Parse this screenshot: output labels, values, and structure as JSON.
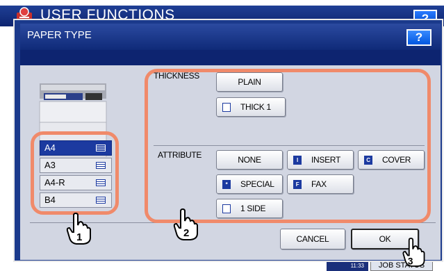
{
  "background": {
    "title": "USER FUNCTIONS",
    "help_label": "?",
    "clock": "11:33",
    "job_status": "JOB STATUS"
  },
  "dialog": {
    "title": "PAPER TYPE",
    "help_label": "?"
  },
  "paper_sizes": [
    {
      "label": "A4",
      "selected": true
    },
    {
      "label": "A3",
      "selected": false
    },
    {
      "label": "A4-R",
      "selected": false
    },
    {
      "label": "B4",
      "selected": false
    }
  ],
  "thickness": {
    "label": "THICKNESS",
    "plain": "PLAIN",
    "thick1": "THICK 1"
  },
  "attribute": {
    "label": "ATTRIBUTE",
    "none": "NONE",
    "insert": "INSERT",
    "cover": "COVER",
    "special": "SPECIAL",
    "fax": "FAX",
    "one_side": "1 SIDE"
  },
  "actions": {
    "cancel": "CANCEL",
    "ok": "OK"
  },
  "callouts": [
    "1",
    "2",
    "3"
  ],
  "colors": {
    "highlight": "#f08a6a",
    "titlebar": "#1b3a8c",
    "selected": "#1c3aa0"
  }
}
